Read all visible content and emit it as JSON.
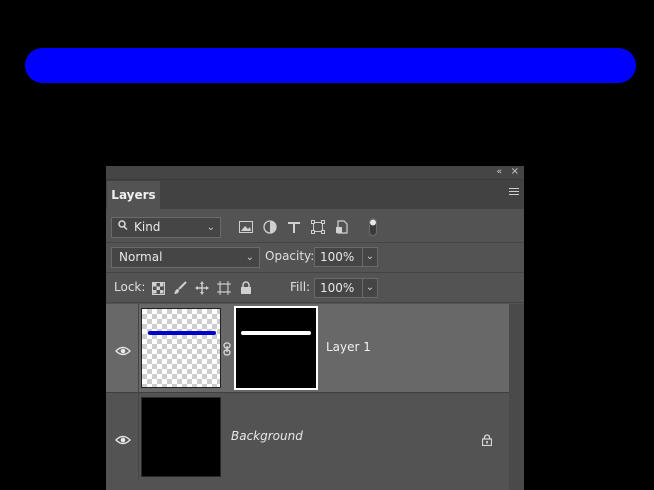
{
  "canvas": {
    "stroke_color": "#0000ff",
    "background": "#000000"
  },
  "panel": {
    "collapse_icon": "«",
    "close_icon": "×",
    "tab_label": "Layers",
    "filter": {
      "kind_label": "Kind",
      "icons": [
        "image-filter-icon",
        "adjustment-filter-icon",
        "type-filter-icon",
        "shape-filter-icon",
        "smart-object-filter-icon"
      ]
    },
    "blend_mode": "Normal",
    "opacity_label": "Opacity:",
    "opacity_value": "100%",
    "lock_label": "Lock:",
    "fill_label": "Fill:",
    "fill_value": "100%",
    "layers": [
      {
        "name": "Layer 1",
        "visible": true,
        "has_mask": true,
        "thumb_color": "#0000cc"
      },
      {
        "name": "Background",
        "visible": true,
        "locked": true,
        "thumb_color": "#000000"
      }
    ]
  }
}
